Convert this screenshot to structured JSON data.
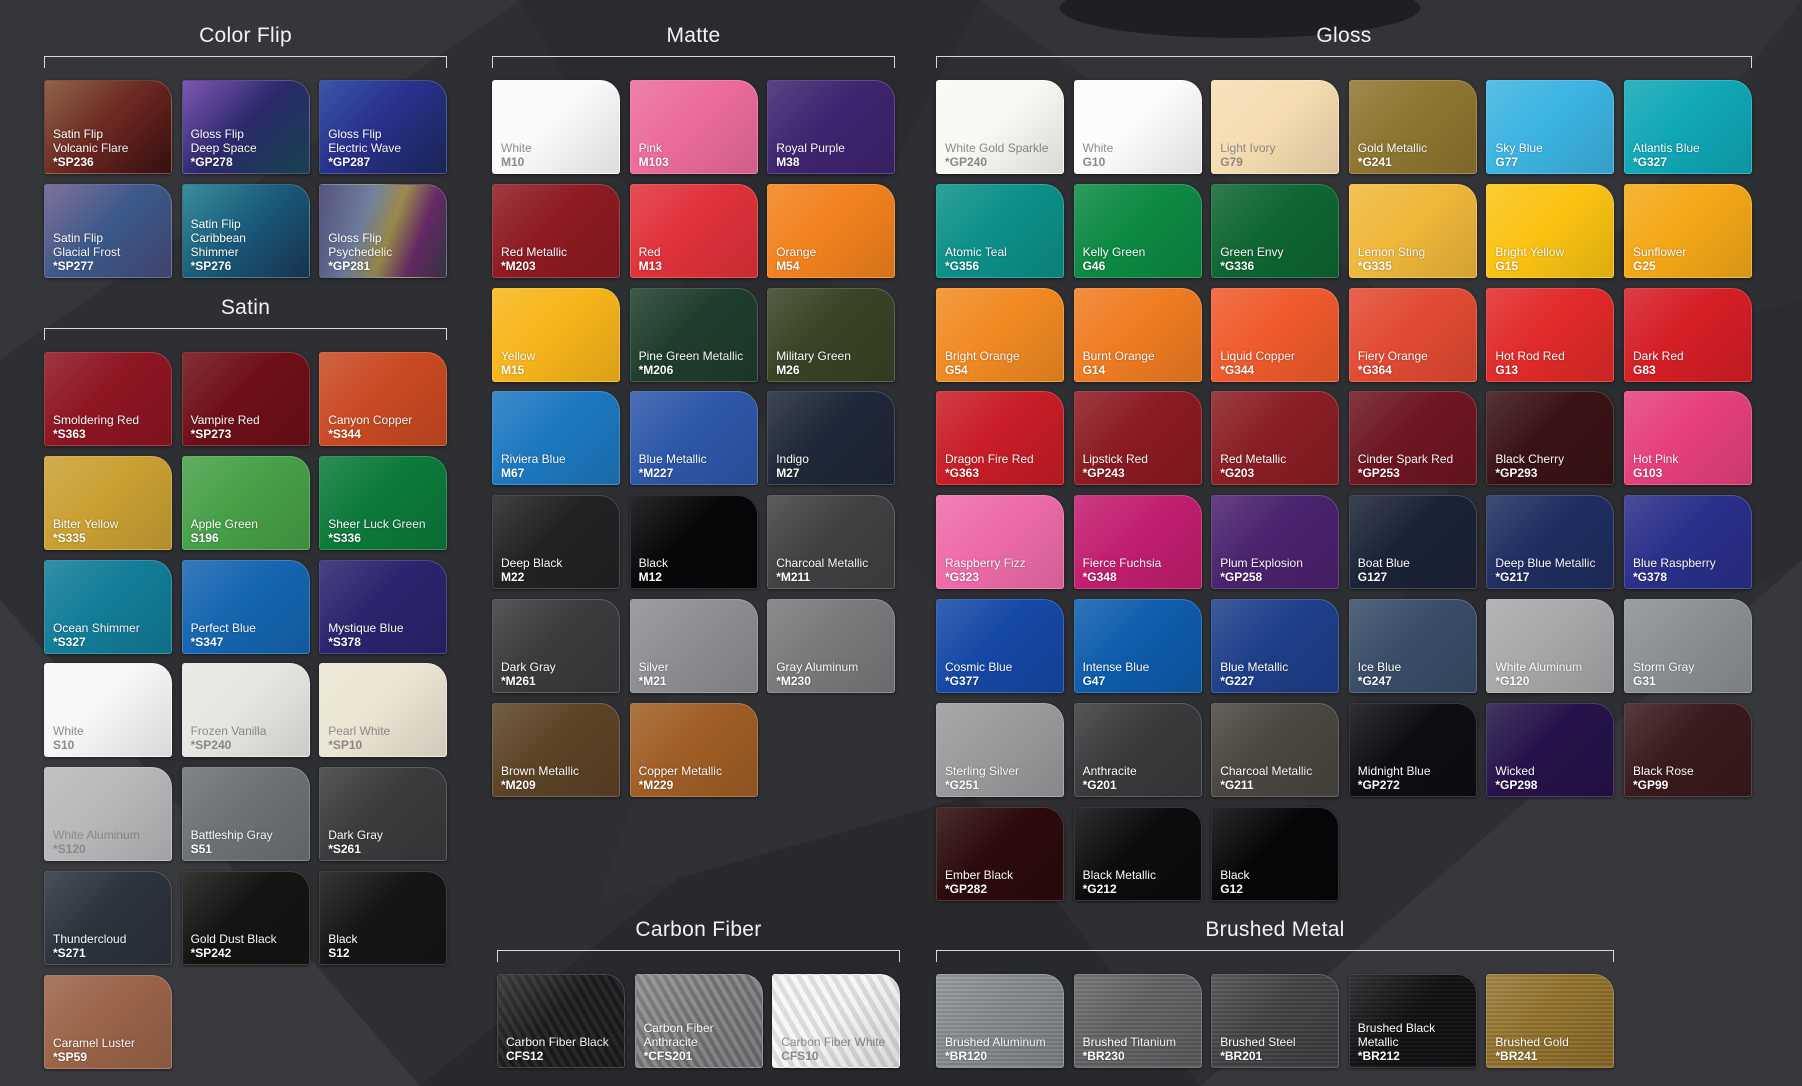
{
  "theme": {
    "background": "#2e2f33",
    "title_color": "#f2f2f2",
    "bracket_color": "#d8d8d8"
  },
  "sections": [
    {
      "id": "color-flip",
      "title": "Color Flip",
      "swatches": [
        {
          "name": "Satin Flip\nVolcanic Flare",
          "code": "*SP236",
          "fill": "linear-gradient(135deg,#7b4a2c,#6a2420 55%,#3a1212)"
        },
        {
          "name": "Gloss Flip\nDeep Space",
          "code": "*GP278",
          "fill": "linear-gradient(135deg,#6a3aa8,#2a2a6a 50%,#1b4a5a)"
        },
        {
          "name": "Gloss Flip\nElectric Wave",
          "code": "*GP287",
          "fill": "linear-gradient(135deg,#1a3a9a,#2a2f8a 50%,#1c2a60)"
        },
        {
          "name": "Satin Flip\nGlacial Frost",
          "code": "*SP277",
          "fill": "linear-gradient(135deg,#6a5a8a,#3a5a8a 50%,#4a4a7a)"
        },
        {
          "name": "Satin Flip\nCaribbean\nShimmer",
          "code": "*SP276",
          "fill": "linear-gradient(135deg,#1a7a8a,#1a5a7a 50%,#1b3a5a)"
        },
        {
          "name": "Gloss Flip\nPsychedelic",
          "code": "*GP281",
          "fill": "linear-gradient(110deg,#3a3a6a,#6a7a9a 35%,#9a8a4a 55%,#6a2a6a 75%,#3a3a4a)"
        }
      ]
    },
    {
      "id": "satin",
      "title": "Satin",
      "swatches": [
        {
          "name": "Smoldering Red",
          "code": "*S363",
          "fill": "#8e1522"
        },
        {
          "name": "Vampire Red",
          "code": "*SP273",
          "fill": "#6e0f18"
        },
        {
          "name": "Canyon Copper",
          "code": "*S344",
          "fill": "#c94a22"
        },
        {
          "name": "Bitter Yellow",
          "code": "*S335",
          "fill": "#c9a032"
        },
        {
          "name": "Apple Green",
          "code": "S196",
          "fill": "#47a048"
        },
        {
          "name": "Sheer Luck Green",
          "code": "*S336",
          "fill": "#0c7a3a"
        },
        {
          "name": "Ocean Shimmer",
          "code": "*S327",
          "fill": "#127d98"
        },
        {
          "name": "Perfect Blue",
          "code": "*S347",
          "fill": "#1565b0"
        },
        {
          "name": "Mystique Blue",
          "code": "*S378",
          "fill": "#2a246e"
        },
        {
          "name": "White",
          "code": "S10",
          "fill": "#f7f7f7",
          "light": true
        },
        {
          "name": "Frozen Vanilla",
          "code": "*SP240",
          "fill": "#e6e6e3",
          "light": true
        },
        {
          "name": "Pearl White",
          "code": "*SP10",
          "fill": "#ece5d3",
          "light": true
        },
        {
          "name": "White Aluminum",
          "code": "*S120",
          "fill": "#b7b8ba",
          "light": true
        },
        {
          "name": "Battleship Gray",
          "code": "S51",
          "fill": "#6c7176"
        },
        {
          "name": "Dark Gray",
          "code": "*S261",
          "fill": "#3a3b3d"
        },
        {
          "name": "Thundercloud",
          "code": "*S271",
          "fill": "#2c333d"
        },
        {
          "name": "Gold Dust Black",
          "code": "*SP242",
          "fill": "#151413"
        },
        {
          "name": "Black",
          "code": "S12",
          "fill": "#151516"
        },
        {
          "name": "Caramel Luster",
          "code": "*SP59",
          "fill": "#9a6448"
        }
      ]
    },
    {
      "id": "matte",
      "title": "Matte",
      "swatches": [
        {
          "name": "White",
          "code": "M10",
          "fill": "#fafafa",
          "light": true
        },
        {
          "name": "Pink",
          "code": "M103",
          "fill": "#ec6b9c"
        },
        {
          "name": "Royal Purple",
          "code": "M38",
          "fill": "#3f2470"
        },
        {
          "name": "Red Metallic",
          "code": "*M203",
          "fill": "#8e1a22"
        },
        {
          "name": "Red",
          "code": "M13",
          "fill": "#e0323a"
        },
        {
          "name": "Orange",
          "code": "M54",
          "fill": "#f2821e"
        },
        {
          "name": "Yellow",
          "code": "M15",
          "fill": "#f7b51a"
        },
        {
          "name": "Pine Green Metallic",
          "code": "*M206",
          "fill": "#1f3d2c"
        },
        {
          "name": "Military Green",
          "code": "M26",
          "fill": "#3a4225"
        },
        {
          "name": "Riviera Blue",
          "code": "M67",
          "fill": "#1d78c0"
        },
        {
          "name": "Blue Metallic",
          "code": "*M227",
          "fill": "#2d57a8"
        },
        {
          "name": "Indigo",
          "code": "M27",
          "fill": "#1f2838"
        },
        {
          "name": "Deep Black",
          "code": "M22",
          "fill": "#222224"
        },
        {
          "name": "Black",
          "code": "M12",
          "fill": "#060608"
        },
        {
          "name": "Charcoal Metallic",
          "code": "*M211",
          "fill": "#404142"
        },
        {
          "name": "Dark Gray",
          "code": "*M261",
          "fill": "#3a3b3d"
        },
        {
          "name": "Silver",
          "code": "*M21",
          "fill": "#8c8e91"
        },
        {
          "name": "Gray Aluminum",
          "code": "*M230",
          "fill": "#77797b"
        },
        {
          "name": "Brown Metallic",
          "code": "*M209",
          "fill": "#5c4326"
        },
        {
          "name": "Copper Metallic",
          "code": "*M229",
          "fill": "#a05e25"
        }
      ]
    },
    {
      "id": "gloss",
      "title": "Gloss",
      "swatches": [
        {
          "name": "White Gold Sparkle",
          "code": "*GP240",
          "fill": "#f9f8f2",
          "light": true
        },
        {
          "name": "White",
          "code": "G10",
          "fill": "#fcfcfc",
          "light": true
        },
        {
          "name": "Light Ivory",
          "code": "G79",
          "fill": "#f6ddb1",
          "light": true
        },
        {
          "name": "Gold Metallic",
          "code": "*G241",
          "fill": "#8e7530"
        },
        {
          "name": "Sky Blue",
          "code": "G77",
          "fill": "#3cb4e2"
        },
        {
          "name": "Atlantis Blue",
          "code": "*G327",
          "fill": "#10a7b6"
        },
        {
          "name": "Atomic Teal",
          "code": "*G356",
          "fill": "#0c9089"
        },
        {
          "name": "Kelly Green",
          "code": "G46",
          "fill": "#0c8a43"
        },
        {
          "name": "Green Envy",
          "code": "*G336",
          "fill": "#0e6633"
        },
        {
          "name": "Lemon Sting",
          "code": "*G335",
          "fill": "#f0b83a"
        },
        {
          "name": "Bright Yellow",
          "code": "G15",
          "fill": "#fbc312"
        },
        {
          "name": "Sunflower",
          "code": "G25",
          "fill": "#f4a818"
        },
        {
          "name": "Bright Orange",
          "code": "G54",
          "fill": "#f28a22"
        },
        {
          "name": "Burnt Orange",
          "code": "G14",
          "fill": "#f07c22"
        },
        {
          "name": "Liquid Copper",
          "code": "*G344",
          "fill": "#f05a2c"
        },
        {
          "name": "Fiery Orange",
          "code": "*G364",
          "fill": "#e24a32"
        },
        {
          "name": "Hot Rod Red",
          "code": "G13",
          "fill": "#e22a2a"
        },
        {
          "name": "Dark Red",
          "code": "G83",
          "fill": "#d61e26"
        },
        {
          "name": "Dragon Fire Red",
          "code": "*G363",
          "fill": "#c81d26"
        },
        {
          "name": "Lipstick Red",
          "code": "*GP243",
          "fill": "#8c1a22"
        },
        {
          "name": "Red Metallic",
          "code": "*G203",
          "fill": "#8a1e24"
        },
        {
          "name": "Cinder Spark Red",
          "code": "*GP253",
          "fill": "#6e1622"
        },
        {
          "name": "Black Cherry",
          "code": "*GP293",
          "fill": "#3a1216"
        },
        {
          "name": "Hot Pink",
          "code": "G103",
          "fill": "#e6407c"
        },
        {
          "name": "Raspberry Fizz",
          "code": "*G323",
          "fill": "#ee6ba8"
        },
        {
          "name": "Fierce Fuchsia",
          "code": "*G348",
          "fill": "#c21e6e"
        },
        {
          "name": "Plum Explosion",
          "code": "*GP258",
          "fill": "#4a226e"
        },
        {
          "name": "Boat Blue",
          "code": "G127",
          "fill": "#1a2336"
        },
        {
          "name": "Deep Blue Metallic",
          "code": "*G217",
          "fill": "#1f2e60"
        },
        {
          "name": "Blue Raspberry",
          "code": "*G378",
          "fill": "#2a2f8a"
        },
        {
          "name": "Cosmic Blue",
          "code": "*G377",
          "fill": "#1548a6"
        },
        {
          "name": "Intense Blue",
          "code": "G47",
          "fill": "#0e5cac"
        },
        {
          "name": "Blue Metallic",
          "code": "*G227",
          "fill": "#1e3f8a"
        },
        {
          "name": "Ice Blue",
          "code": "*G247",
          "fill": "#3a4c68"
        },
        {
          "name": "White Aluminum",
          "code": "*G120",
          "fill": "#a6a8aa"
        },
        {
          "name": "Storm Gray",
          "code": "G31",
          "fill": "#8c8f91"
        },
        {
          "name": "Sterling Silver",
          "code": "*G251",
          "fill": "#989a9c"
        },
        {
          "name": "Anthracite",
          "code": "*G201",
          "fill": "#383a3c"
        },
        {
          "name": "Charcoal Metallic",
          "code": "*G211",
          "fill": "#4a4640"
        },
        {
          "name": "Midnight Blue",
          "code": "*GP272",
          "fill": "#0e0e12"
        },
        {
          "name": "Wicked",
          "code": "*GP298",
          "fill": "#26124a"
        },
        {
          "name": "Black Rose",
          "code": "*GP99",
          "fill": "#3a1a1c"
        },
        {
          "name": "Ember Black",
          "code": "*GP282",
          "fill": "#2c0a0c"
        },
        {
          "name": "Black Metallic",
          "code": "*G212",
          "fill": "#0c0c0e"
        },
        {
          "name": "Black",
          "code": "G12",
          "fill": "#060608"
        }
      ]
    },
    {
      "id": "carbon-fiber",
      "title": "Carbon Fiber",
      "swatches": [
        {
          "name": "Carbon Fiber Black",
          "code": "CFS12",
          "fill": "repeating-linear-gradient(60deg,#2a2a2c 0 4px,#1a1a1c 4px 8px)"
        },
        {
          "name": "Carbon Fiber\nAnthracite",
          "code": "*CFS201",
          "fill": "repeating-linear-gradient(60deg,#8a8c8e 0 4px,#6c6e70 4px 8px)"
        },
        {
          "name": "Carbon Fiber White",
          "code": "CFS10",
          "fill": "repeating-linear-gradient(60deg,#f6f6f6 0 5px,#dadada 5px 10px)",
          "light": true
        }
      ]
    },
    {
      "id": "brushed-metal",
      "title": "Brushed Metal",
      "swatches": [
        {
          "name": "Brushed Aluminum",
          "code": "*BR120",
          "fill": "repeating-linear-gradient(0deg,#8e9194 0 2px,#7c7f82 2px 4px)"
        },
        {
          "name": "Brushed Titanium",
          "code": "*BR230",
          "fill": "repeating-linear-gradient(0deg,#6a6a6c 0 2px,#5a5a5c 2px 4px)"
        },
        {
          "name": "Brushed Steel",
          "code": "*BR201",
          "fill": "repeating-linear-gradient(0deg,#4a4b4d 0 2px,#3c3d3f 2px 4px)"
        },
        {
          "name": "Brushed Black Metallic",
          "code": "*BR212",
          "fill": "repeating-linear-gradient(0deg,#1a1a1c 0 2px,#101012 2px 4px)"
        },
        {
          "name": "Brushed Gold",
          "code": "*BR241",
          "fill": "repeating-linear-gradient(0deg,#9a7a34 0 2px,#86692a 2px 4px)"
        }
      ]
    }
  ]
}
